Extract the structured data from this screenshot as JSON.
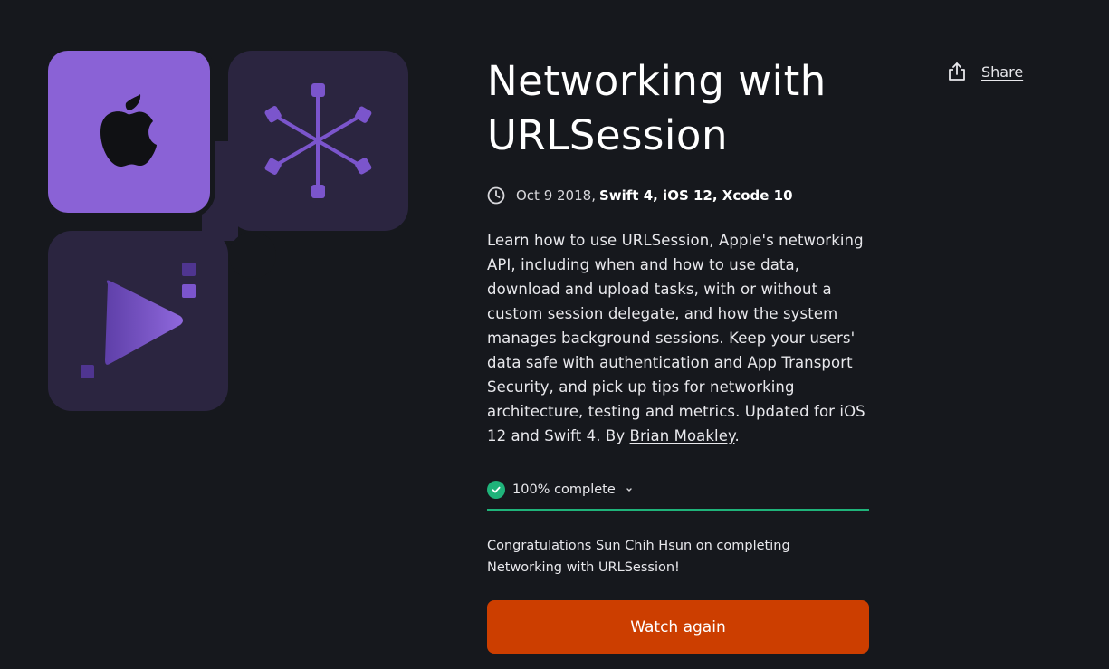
{
  "course": {
    "title_line1": "Networking with",
    "title_line2": "URLSession",
    "date": "Oct 9 2018,",
    "tech": "Swift 4, iOS 12, Xcode 10",
    "description_text": "Learn how to use URLSession, Apple's networking API, including when and how to use data, download and upload tasks, with or without a custom session delegate, and how the system manages background sessions. Keep your users' data safe with authentication and App Transport Security, and pick up tips for networking architecture, testing and metrics. Updated for iOS 12 and Swift 4. By ",
    "author": "Brian Moakley",
    "description_end": "."
  },
  "share": {
    "label": "Share",
    "icon": "share-icon"
  },
  "progress": {
    "label": "100% complete",
    "percent": 100,
    "icon": "check-circle-icon",
    "expand_icon": "chevron-down-icon"
  },
  "congrats_message": "Congratulations Sun Chih Hsun on completing Networking with URLSession!",
  "actions": {
    "watch_again_label": "Watch again"
  },
  "colors": {
    "background": "#16181d",
    "accent_purple": "#8a62d6",
    "tile_dark": "#2b2540",
    "progress_green": "#1fb37a",
    "button_orange": "#cc3e00"
  },
  "artwork": {
    "tiles": [
      "apple-logo-icon",
      "network-hub-icon",
      "play-icon"
    ]
  }
}
